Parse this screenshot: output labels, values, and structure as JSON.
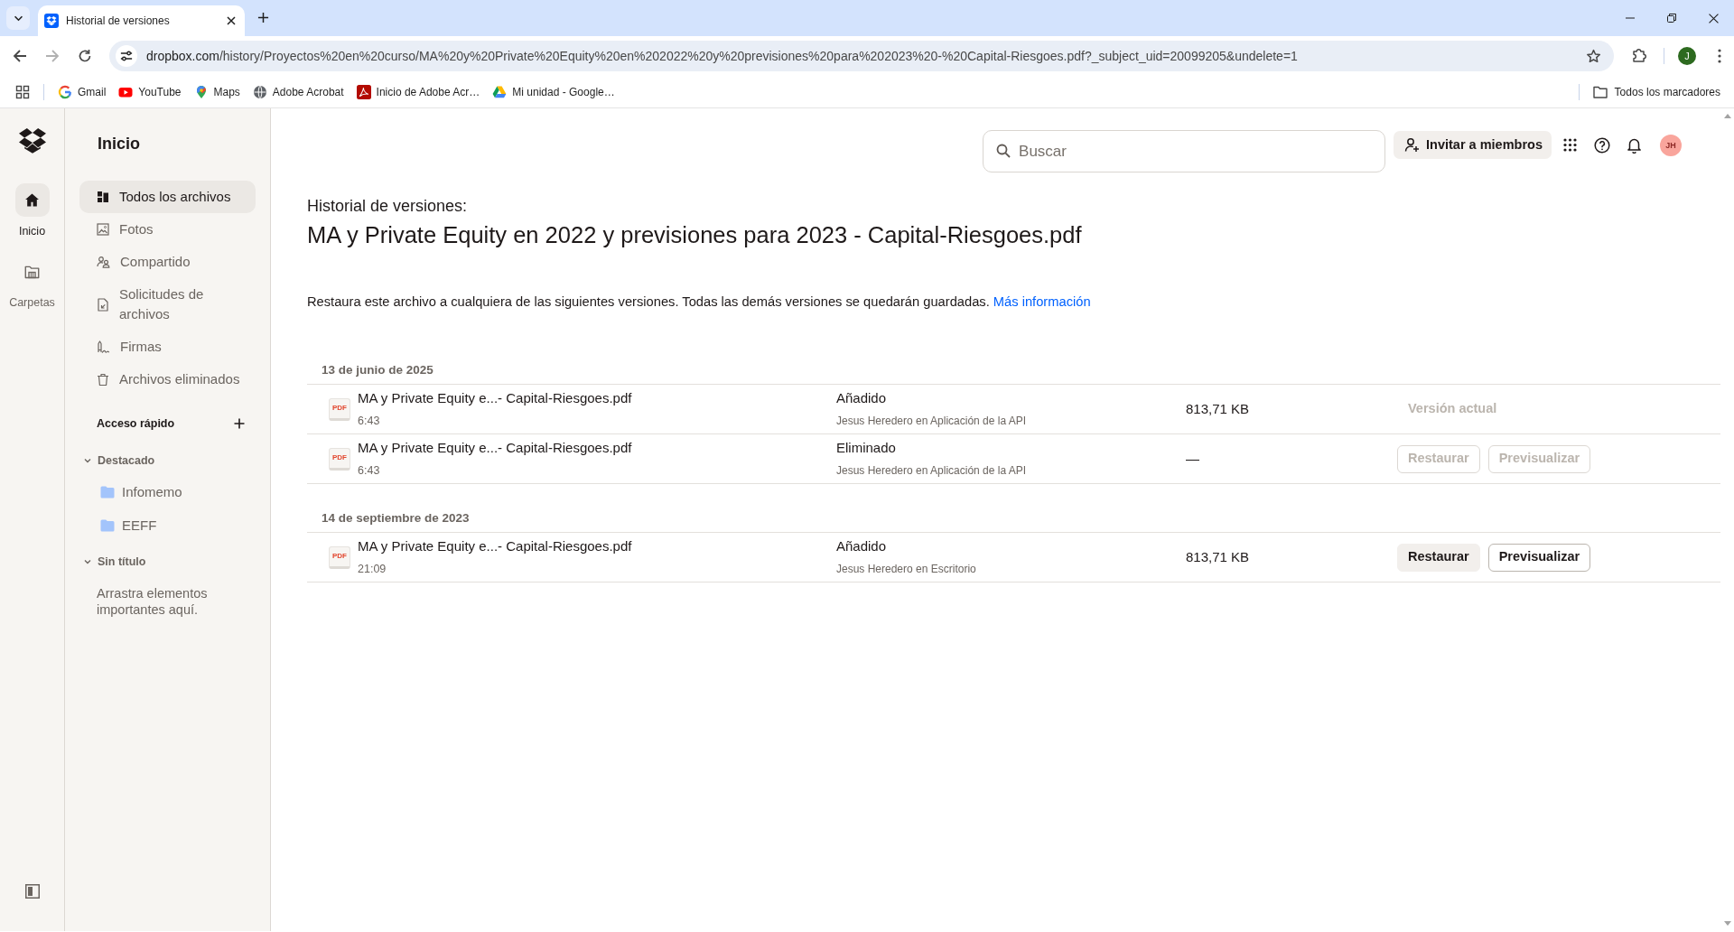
{
  "browser": {
    "tabs": [
      {
        "title": "Historial de versiones",
        "selected": true
      }
    ],
    "address_bar": {
      "host": "dropbox.com",
      "path": "/history/Proyectos%20en%20curso/MA%20y%20Private%20Equity%20en%202022%20y%20previsiones%20para%202023%20-%20Capital-Riesgoes.pdf?_subject_uid=20099205&undelete=1"
    },
    "profile_initial": "J",
    "bookmarks": [
      {
        "label": "Gmail"
      },
      {
        "label": "YouTube"
      },
      {
        "label": "Maps"
      },
      {
        "label": "Adobe Acrobat"
      },
      {
        "label": "Inicio de Adobe Acr…"
      },
      {
        "label": "Mi unidad - Google…"
      }
    ],
    "bookmarks_folder": "Todos los marcadores"
  },
  "rail": {
    "items": [
      {
        "label": "Inicio",
        "selected": true
      },
      {
        "label": "Carpetas",
        "selected": false
      }
    ]
  },
  "sidebar": {
    "title": "Inicio",
    "nav": [
      {
        "label": "Todos los archivos",
        "selected": true
      },
      {
        "label": "Fotos",
        "selected": false
      },
      {
        "label": "Compartido",
        "selected": false
      },
      {
        "label": "Solicitudes de archivos",
        "selected": false
      },
      {
        "label": "Firmas",
        "selected": false
      },
      {
        "label": "Archivos eliminados",
        "selected": false
      }
    ],
    "quick_access": {
      "title": "Acceso rápido",
      "groups": [
        {
          "title": "Destacado",
          "expanded": true,
          "items": [
            {
              "label": "Infomemo"
            },
            {
              "label": "EEFF"
            }
          ]
        },
        {
          "title": "Sin título",
          "expanded": true,
          "hint": "Arrastra elementos importantes aquí."
        }
      ]
    }
  },
  "header": {
    "search": {
      "placeholder": "Buscar"
    },
    "invite_button": "Invitar a miembros",
    "avatar_initials": "JH"
  },
  "history": {
    "heading": "Historial de versiones:",
    "file_name": "MA y Private Equity en 2022 y previsiones para 2023 - Capital-Riesgoes.pdf",
    "description": "Restaura este archivo a cualquiera de las siguientes versiones. Todas las demás versiones se quedarán guardadas.",
    "link": "Más información",
    "groups": [
      {
        "date": "13 de junio de 2025",
        "versions": [
          {
            "type_label": "PDF",
            "name": "MA y Private Equity e...- Capital-Riesgoes.pdf",
            "time": "6:43",
            "event": "Añadido",
            "source": "Jesus Heredero en Aplicación de la API",
            "size": "813,71 KB",
            "kind": "current",
            "label": "Versión actual"
          },
          {
            "type_label": "PDF",
            "name": "MA y Private Equity e...- Capital-Riesgoes.pdf",
            "time": "6:43",
            "event": "Eliminado",
            "source": "Jesus Heredero en Aplicación de la API",
            "size": "—",
            "kind": "restorable",
            "disabled": true,
            "buttons": [
              {
                "label": "Restaurar",
                "kind": "secondary"
              },
              {
                "label": "Previsualizar",
                "kind": "outline"
              }
            ]
          }
        ]
      },
      {
        "date": "14 de septiembre de 2023",
        "versions": [
          {
            "type_label": "PDF",
            "name": "MA y Private Equity e...- Capital-Riesgoes.pdf",
            "time": "21:09",
            "event": "Añadido",
            "source": "Jesus Heredero en Escritorio",
            "size": "813,71 KB",
            "kind": "restorable",
            "disabled": false,
            "buttons": [
              {
                "label": "Restaurar",
                "kind": "secondary"
              },
              {
                "label": "Previsualizar",
                "kind": "outline"
              }
            ]
          }
        ]
      }
    ]
  }
}
